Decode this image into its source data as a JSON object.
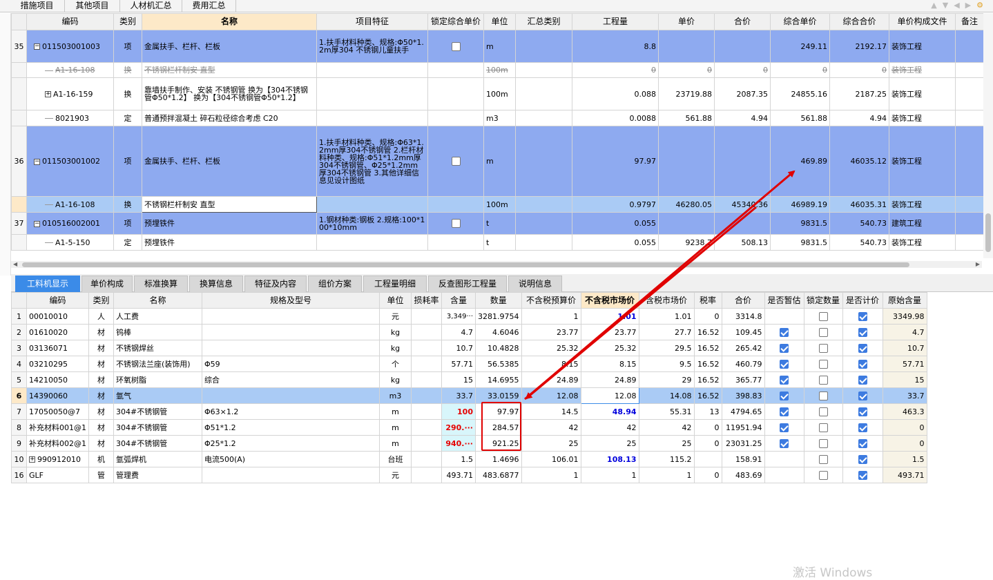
{
  "top_tabs": [
    "措施项目",
    "其他项目",
    "人材机汇总",
    "费用汇总"
  ],
  "upper_headers": [
    "",
    "编码",
    "类别",
    "名称",
    "项目特征",
    "锁定综合单价",
    "单位",
    "汇总类别",
    "工程量",
    "单价",
    "合价",
    "综合单价",
    "综合合价",
    "单价构成文件",
    "备注"
  ],
  "upper_rows": [
    {
      "rn": "35",
      "code": "011503001003",
      "toggle": "−",
      "type": "项",
      "name": "金属扶手、栏杆、栏板",
      "feature": "1.扶手材料种类、规格:Φ50*1.2m厚304 不锈钢儿童扶手",
      "lock": "box",
      "unit": "m",
      "sumcat": "",
      "qty": "8.8",
      "price": "",
      "total": "",
      "cunit": "249.11",
      "ctotal": "2192.17",
      "file": "装饰工程",
      "style": "blue"
    },
    {
      "rn": "",
      "code": "A1-16-108",
      "toggle": "",
      "type": "换",
      "name": "不锈钢栏杆制安 直型",
      "feature": "",
      "lock": "",
      "unit": "100m",
      "sumcat": "",
      "qty": "0",
      "price": "0",
      "total": "0",
      "cunit": "0",
      "ctotal": "0",
      "file": "装饰工程",
      "style": "strike"
    },
    {
      "rn": "",
      "code": "A1-16-159",
      "toggle": "+",
      "type": "换",
      "name": "靠墙扶手制作、安装 不锈钢管 换为【304不锈钢管Φ50*1.2】 换为【304不锈钢管Φ50*1.2】",
      "feature": "",
      "lock": "",
      "unit": "100m",
      "sumcat": "",
      "qty": "0.088",
      "price": "23719.88",
      "total": "2087.35",
      "cunit": "24855.16",
      "ctotal": "2187.25",
      "file": "装饰工程",
      "style": ""
    },
    {
      "rn": "",
      "code": "8021903",
      "toggle": "",
      "type": "定",
      "name": "普通预拌混凝土 碎石粒径综合考虑 C20",
      "feature": "",
      "lock": "",
      "unit": "m3",
      "sumcat": "",
      "qty": "0.0088",
      "price": "561.88",
      "total": "4.94",
      "cunit": "561.88",
      "ctotal": "4.94",
      "file": "装饰工程",
      "style": ""
    },
    {
      "rn": "36",
      "code": "011503001002",
      "toggle": "−",
      "type": "项",
      "name": "金属扶手、栏杆、栏板",
      "feature": "1.扶手材料种类、规格:Φ63*1.2mm厚304不锈钢管 2.栏杆材料种类、规格:Φ51*1.2mm厚304不锈钢管、Φ25*1.2mm厚304不锈钢管 3.其他详细信息见设计图纸",
      "lock": "box",
      "unit": "m",
      "sumcat": "",
      "qty": "97.97",
      "price": "",
      "total": "",
      "cunit": "469.89",
      "ctotal": "46035.12",
      "file": "装饰工程",
      "style": "blue"
    },
    {
      "rn": "",
      "code": "A1-16-108",
      "toggle": "",
      "type": "换",
      "name": "不锈钢栏杆制安 直型",
      "feature": "",
      "lock": "",
      "unit": "100m",
      "sumcat": "",
      "qty": "0.9797",
      "price": "46280.05",
      "total": "45340.36",
      "cunit": "46989.19",
      "ctotal": "46035.31",
      "file": "装饰工程",
      "style": "light"
    },
    {
      "rn": "37",
      "code": "010516002001",
      "toggle": "−",
      "type": "项",
      "name": "预埋铁件",
      "feature": "1.钢材种类:钢板 2.规格:100*100*10mm",
      "lock": "box",
      "unit": "t",
      "sumcat": "",
      "qty": "0.055",
      "price": "",
      "total": "",
      "cunit": "9831.5",
      "ctotal": "540.73",
      "file": "建筑工程",
      "style": "blue"
    },
    {
      "rn": "",
      "code": "A1-5-150",
      "toggle": "",
      "type": "定",
      "name": "预埋铁件",
      "feature": "",
      "lock": "",
      "unit": "t",
      "sumcat": "",
      "qty": "0.055",
      "price": "9238.7",
      "total": "508.13",
      "cunit": "9831.5",
      "ctotal": "540.73",
      "file": "装饰工程",
      "style": ""
    }
  ],
  "lower_tabs": [
    "工料机显示",
    "单价构成",
    "标准换算",
    "换算信息",
    "特征及内容",
    "组价方案",
    "工程量明细",
    "反查图形工程量",
    "说明信息"
  ],
  "lower_headers": [
    "",
    "编码",
    "类别",
    "名称",
    "规格及型号",
    "单位",
    "损耗率",
    "含量",
    "数量",
    "不含税预算价",
    "不含税市场价",
    "含税市场价",
    "税率",
    "合价",
    "是否暂估",
    "锁定数量",
    "是否计价",
    "原始含量"
  ],
  "lower_rows": [
    {
      "rn": "1",
      "code": "00010010",
      "type": "人",
      "name": "人工费",
      "spec": "",
      "unit": "元",
      "loss": "",
      "content": "3,349···",
      "qty": "3281.9754",
      "budget": "1",
      "mkt": "1.01",
      "taxmkt": "1.01",
      "tax": "0",
      "total": "3314.8",
      "est": false,
      "lockq": false,
      "price": true,
      "orig": "3349.98",
      "style": "",
      "mktcls": "blue"
    },
    {
      "rn": "2",
      "code": "01610020",
      "type": "材",
      "name": "钨棒",
      "spec": "",
      "unit": "kg",
      "loss": "",
      "content": "4.7",
      "qty": "4.6046",
      "budget": "23.77",
      "mkt": "23.77",
      "taxmkt": "27.7",
      "tax": "16.52",
      "total": "109.45",
      "est": true,
      "lockq": false,
      "price": true,
      "orig": "4.7",
      "style": "",
      "mktcls": ""
    },
    {
      "rn": "3",
      "code": "03136071",
      "type": "材",
      "name": "不锈钢焊丝",
      "spec": "",
      "unit": "kg",
      "loss": "",
      "content": "10.7",
      "qty": "10.4828",
      "budget": "25.32",
      "mkt": "25.32",
      "taxmkt": "29.5",
      "tax": "16.52",
      "total": "265.42",
      "est": true,
      "lockq": false,
      "price": true,
      "orig": "10.7",
      "style": "",
      "mktcls": ""
    },
    {
      "rn": "4",
      "code": "03210295",
      "type": "材",
      "name": "不锈钢法兰座(装饰用)",
      "spec": "Φ59",
      "unit": "个",
      "loss": "",
      "content": "57.71",
      "qty": "56.5385",
      "budget": "8.15",
      "mkt": "8.15",
      "taxmkt": "9.5",
      "tax": "16.52",
      "total": "460.79",
      "est": true,
      "lockq": false,
      "price": true,
      "orig": "57.71",
      "style": "",
      "mktcls": ""
    },
    {
      "rn": "5",
      "code": "14210050",
      "type": "材",
      "name": "环氧树脂",
      "spec": "综合",
      "unit": "kg",
      "loss": "",
      "content": "15",
      "qty": "14.6955",
      "budget": "24.89",
      "mkt": "24.89",
      "taxmkt": "29",
      "tax": "16.52",
      "total": "365.77",
      "est": true,
      "lockq": false,
      "price": true,
      "orig": "15",
      "style": "",
      "mktcls": ""
    },
    {
      "rn": "6",
      "code": "14390060",
      "type": "材",
      "name": "氩气",
      "spec": "",
      "unit": "m3",
      "loss": "",
      "content": "33.7",
      "qty": "33.0159",
      "budget": "12.08",
      "mkt": "12.08",
      "taxmkt": "14.08",
      "tax": "16.52",
      "total": "398.83",
      "est": true,
      "lockq": false,
      "price": true,
      "orig": "33.7",
      "style": "sel",
      "mktcls": ""
    },
    {
      "rn": "7",
      "code": "17050050@7",
      "type": "材",
      "name": "304#不锈钢管",
      "spec": "Φ63×1.2",
      "unit": "m",
      "loss": "",
      "content": "100",
      "qty": "97.97",
      "budget": "14.5",
      "mkt": "48.94",
      "taxmkt": "55.31",
      "tax": "13",
      "total": "4794.65",
      "est": true,
      "lockq": false,
      "price": true,
      "orig": "463.3",
      "style": "",
      "mktcls": "blue",
      "contentcls": "red"
    },
    {
      "rn": "8",
      "code": "补充材料001@1",
      "type": "材",
      "name": "304#不锈钢管",
      "spec": "Φ51*1.2",
      "unit": "m",
      "loss": "",
      "content": "290.···",
      "qty": "284.57",
      "budget": "42",
      "mkt": "42",
      "taxmkt": "42",
      "tax": "0",
      "total": "11951.94",
      "est": true,
      "lockq": false,
      "price": true,
      "orig": "0",
      "style": "",
      "mktcls": "",
      "contentcls": "red"
    },
    {
      "rn": "9",
      "code": "补充材料002@1",
      "type": "材",
      "name": "304#不锈钢管",
      "spec": "Φ25*1.2",
      "unit": "m",
      "loss": "",
      "content": "940.···",
      "qty": "921.25",
      "budget": "25",
      "mkt": "25",
      "taxmkt": "25",
      "tax": "0",
      "total": "23031.25",
      "est": true,
      "lockq": false,
      "price": true,
      "orig": "0",
      "style": "",
      "mktcls": "",
      "contentcls": "red"
    },
    {
      "rn": "10",
      "code": "990912010",
      "type": "机",
      "name": "氩弧焊机",
      "spec": "电流500(A)",
      "unit": "台班",
      "loss": "",
      "content": "1.5",
      "qty": "1.4696",
      "budget": "106.01",
      "mkt": "108.13",
      "taxmkt": "115.2",
      "tax": "",
      "total": "158.91",
      "est": false,
      "lockq": false,
      "price": true,
      "orig": "1.5",
      "style": "",
      "mktcls": "blue",
      "toggle": "+"
    },
    {
      "rn": "16",
      "code": "GLF",
      "type": "管",
      "name": "管理费",
      "spec": "",
      "unit": "元",
      "loss": "",
      "content": "493.71",
      "qty": "483.6877",
      "budget": "1",
      "mkt": "1",
      "taxmkt": "1",
      "tax": "0",
      "total": "483.69",
      "est": false,
      "lockq": false,
      "price": true,
      "orig": "493.71",
      "style": "",
      "mktcls": ""
    }
  ],
  "watermark": "激活 Windows",
  "colors": {
    "selected_row": "#aacbf5",
    "item_row": "#8eaaf0",
    "active_tab": "#3b8be8",
    "annotation": "#e00000"
  }
}
